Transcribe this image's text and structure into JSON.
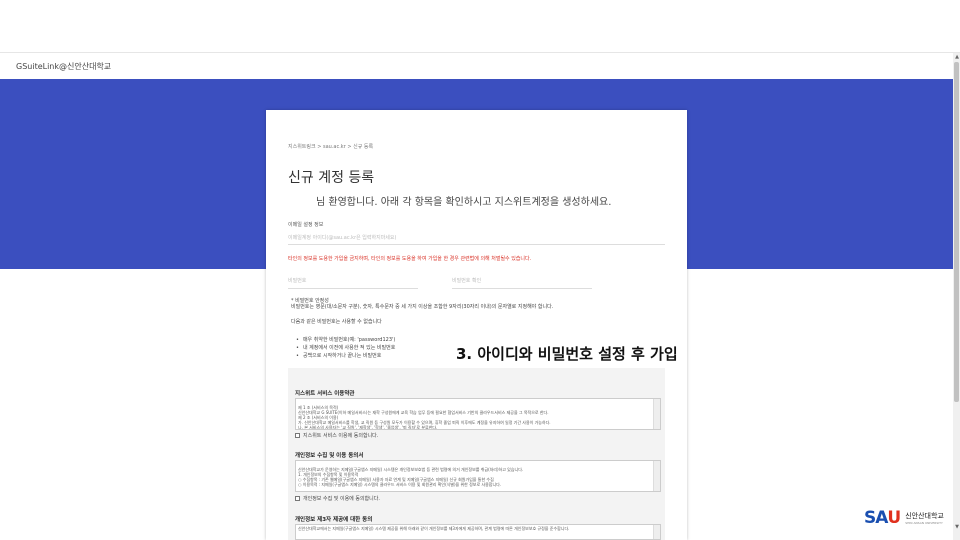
{
  "window": {
    "title": "GSuiteLink@신안산대학교"
  },
  "colors": {
    "banner": "#3b4fbf",
    "warning": "#d93025",
    "logo_blue": "#1a4fb0",
    "logo_red": "#e0301e"
  },
  "form": {
    "breadcrumb": "지스위트링크 > sau.ac.kr > 신규 등록",
    "heading": "신규 계정 등록",
    "welcome": "님 환영합니다. 아래 각 항목을 확인하시고 지스위트계정을 생성하세요.",
    "email_label": "이메일 설정 정보",
    "email_placeholder": "이메일계정 아이디(@sau.ac.kr은 입력하지마세요)",
    "warning": "타인의 정보를 도용한 가입을 금지하며, 타인의 정보를 도용을 하여 가입을 한 경우 관련법에 의해 처벌될수 있습니다.",
    "password_placeholder": "비밀번호",
    "password_confirm_placeholder": "비밀번호 확인",
    "pw_rule_title": "* 비밀번호 안정성",
    "pw_rule_text": "비밀번호는 영문(대/소문자 구분), 숫자, 특수문자 중 세 가지 이상을 조합한 9자리(30자리 이내)의 문자열로 지정해야 합니다.",
    "pw_disallow_title": "다음과 같은 비밀번호는 사용할 수 없습니다",
    "pw_disallow_items": [
      "매우 취약한 비밀번호(예: 'password123')",
      "내 계정에서 이전에 사용한 적 있는 비밀번호",
      "공백으로 시작하거나 끝나는 비밀번호"
    ]
  },
  "terms": {
    "service_title": "지스위트 서비스 이용약관",
    "service_body": "제 1 조 (서비스의 목적)\n신안산대학교 G SUITE(이하 메일서비스)는 재학 구성원에게 교육 학습 업무 등에 필요한 협업서비스 기반의 클라우드서비스 제공을 그 목적으로 한다.\n제 2 조 (서비스의 이용)\n가. 신안산대학교 메일서비스를 학생, 교 직원 등 구성원 모두가 이용할 수 있으며, 휴학 졸업 퇴직 이후에도 계정을 유지하여 일정 기간 사용이 가능하다.\n나. 본 서비스의 사용자는 '교 직원', '재학생', '학생', '졸업생', '퇴 직자'로 분류한다.",
    "service_agree": "지스위트 서비스 이용에 동의합니다.",
    "privacy_title": "개인정보 수집 및 이용 동의서",
    "privacy_body": "신안산대학교가 운영하는 지메일(구글앱스 지메일) 시스템은 개인정보보호법 등 관련 법령에 의거 개인정보를 취급(처리)하고 있습니다.\n1. 개인정보의 수집항목 및 이용목적\n○ 수집항목 : 기존 웹메일(구글앱스 지메일) 사용자 자료 연계 및 지메일(구글앱스 지메일) 신규 회원가입을 통한 수집\n○ 이용목적 : 지메일(구글앱스 지메일) 시스템의 클라우드 서비스 이용 및 회원관리 확인(식별)을 위한 정보로 사용합니다.",
    "privacy_agree": "개인정보 수집 및 이용에 동의합니다.",
    "third_title": "개인정보 제3자 제공에 대한 동의",
    "third_body": "신안산대학교에서는 지메일(구글앱스 지메일) 시스템 제공을 위해 아래와 같이 개인정보를 제3자에게 제공하며, 관계 법령에 따른 개인정보보호 규정을 준수합니다."
  },
  "annotation": {
    "text": "3. 아이디와 비밀번호 설정 후 가입"
  },
  "logo": {
    "mark_main": "SA",
    "mark_accent": "U",
    "name_ko": "신안산대학교",
    "name_en": "SHIN ANSAN UNIVERSITY"
  }
}
